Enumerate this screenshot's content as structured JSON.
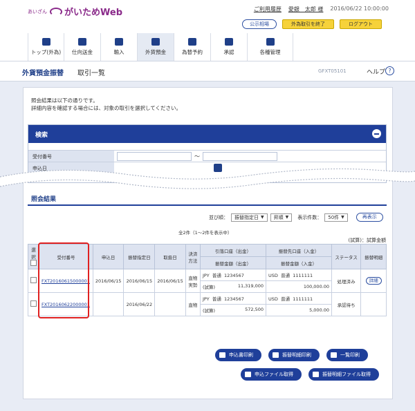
{
  "header": {
    "logo_small": "あいざん",
    "logo_main": "がいためWeb",
    "links": [
      "ご利用履歴",
      "愛銀　太郎 様"
    ],
    "timestamp": "2016/06/22 10:00:00",
    "buttons": {
      "rate": "公示相場",
      "end_fx": "外為取引を終了",
      "logout": "ログアウト"
    }
  },
  "nav": [
    {
      "label": "トップ(外為)",
      "icon": "home-icon"
    },
    {
      "label": "仕向送金",
      "icon": "remit-icon"
    },
    {
      "label": "輸入",
      "icon": "import-icon"
    },
    {
      "label": "外貨預金",
      "icon": "deposit-icon",
      "active": true
    },
    {
      "label": "為替予約",
      "icon": "contract-icon"
    },
    {
      "label": "承認",
      "icon": "approve-icon"
    },
    {
      "label": "各種管理",
      "icon": "admin-icon"
    }
  ],
  "page": {
    "title": "外貨預金振替",
    "subtitle": "取引一覧",
    "screen_id": "GFXT05101",
    "help": "ヘルプ"
  },
  "intro": [
    "照会結果は以下の通りです。",
    "詳細内容を確認する場合には、対象の取引を選択してください。"
  ],
  "search": {
    "title": "検索",
    "fields": [
      {
        "label": "受付番号",
        "range_sep": "～"
      },
      {
        "label": "申込日"
      }
    ]
  },
  "results": {
    "title": "照会結果",
    "sort_label": "並び順：",
    "sort_value": "振替指定日",
    "order_value": "昇順",
    "count_label": "表示件数：",
    "count_value": "50件",
    "redisplay": "再表示",
    "summary": "全2件（1～2件を表示中）",
    "unit_note": "(試算)：試算金額",
    "headers": {
      "select": "選択",
      "receipt_no": "受付番号",
      "apply_date": "申込日",
      "transfer_date": "振替指定日",
      "cancel_date": "取扱日",
      "settle": "決済方法",
      "from_acct": "引落口座（出金）",
      "from_amt": "振替金額（出金）",
      "to_acct": "振替先口座（入金）",
      "to_amt": "振替金額（入金）",
      "status": "ステータス",
      "detail": "振替明細"
    },
    "rows": [
      {
        "receipt_no": "FXT20160615000001",
        "apply_date": "2016/06/15",
        "transfer_date": "2016/06/15",
        "cancel_date": "2016/06/15",
        "settle": "直物実勢",
        "from_ccy": "JPY",
        "from_type": "普通",
        "from_no": "1234567",
        "from_prefix": "(試算)",
        "from_amt": "11,319,000",
        "to_ccy": "USD",
        "to_type": "普通",
        "to_no": "1111111",
        "to_amt": "100,000.00",
        "status": "処理済み",
        "detail": "詳細"
      },
      {
        "receipt_no": "FXT20160622000001",
        "apply_date": "",
        "transfer_date": "2016/06/22",
        "cancel_date": "",
        "settle": "直物",
        "from_ccy": "JPY",
        "from_type": "普通",
        "from_no": "1234567",
        "from_prefix": "(試算)",
        "from_amt": "572,500",
        "to_ccy": "USD",
        "to_type": "普通",
        "to_no": "1111111",
        "to_amt": "5,000.00",
        "status": "承認待ち",
        "detail": ""
      }
    ]
  },
  "actions": {
    "print_application": "申込書印刷",
    "print_details": "振替明細印刷",
    "print_list": "一覧印刷",
    "get_application_file": "申込ファイル取得",
    "get_details_file": "振替明細ファイル取得"
  },
  "colors": {
    "navy": "#1f3f9a",
    "highlight": "#e02020",
    "yellow": "#f6d23a"
  }
}
